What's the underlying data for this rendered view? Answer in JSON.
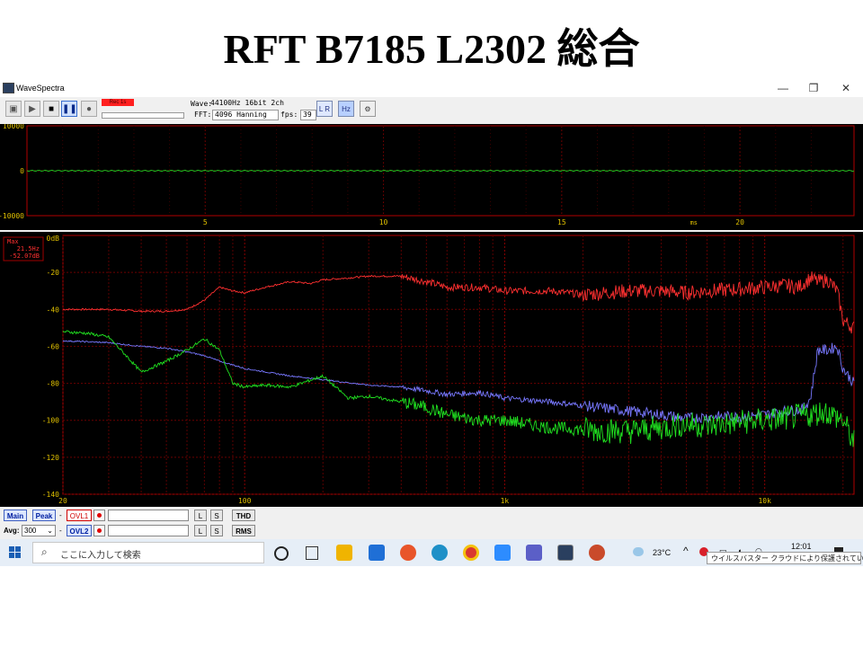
{
  "slide": {
    "title": "RFT B7185 L2302 総合"
  },
  "window": {
    "title": "WaveSpectra",
    "controls": {
      "minimize": "—",
      "restore": "❐",
      "close": "✕"
    }
  },
  "toolbar": {
    "rec_status": "Rec 1s",
    "wave_label": "Wave:",
    "wave_value": "44100Hz 16bit 2ch",
    "fft_label": "FFT:",
    "fft_value": "4096 Hanning",
    "fps_label": "fps:",
    "fps_value": "39",
    "lr_label": "L R",
    "hz_label": "Hz",
    "settings_label": "⚙"
  },
  "wave_plot": {
    "y_ticks": [
      "10000",
      "0",
      "-10000"
    ],
    "x_ticks": [
      {
        "value": 5,
        "label": "5"
      },
      {
        "value": 10,
        "label": "10"
      },
      {
        "value": 15,
        "label": "15"
      },
      {
        "value": 20,
        "label": "20"
      }
    ],
    "x_unit": "ms"
  },
  "chart_data": {
    "type": "line",
    "xscale": "log",
    "xlim": [
      20,
      22050
    ],
    "ylim": [
      -140,
      0
    ],
    "ylabel": "0dB",
    "x_tick_labels": [
      {
        "value": 20,
        "label": "20"
      },
      {
        "value": 100,
        "label": "100"
      },
      {
        "value": 1000,
        "label": "1k"
      },
      {
        "value": 10000,
        "label": "10k"
      }
    ],
    "y_ticks": [
      -20,
      -40,
      -60,
      -80,
      -100,
      -120,
      -140
    ],
    "y_tick_labels": [
      "-20",
      "-40",
      "-60",
      "-80",
      "-100",
      "-120",
      "-140"
    ],
    "max_readout": {
      "label": "Max",
      "freq": "21.5Hz",
      "level": "-52.07dB"
    },
    "series": [
      {
        "color": "#ff3030",
        "x": [
          20,
          30,
          40,
          50,
          60,
          70,
          80,
          90,
          100,
          120,
          150,
          180,
          200,
          250,
          300,
          400,
          500,
          600,
          800,
          1000,
          1500,
          2000,
          3000,
          4000,
          5000,
          6000,
          8000,
          10000,
          12000,
          13500,
          15000,
          16000,
          17500,
          19000,
          20000,
          22000
        ],
        "y": [
          -40,
          -40,
          -41,
          -41,
          -40,
          -35,
          -28,
          -30,
          -31,
          -28,
          -25,
          -26,
          -24,
          -23,
          -22,
          -22,
          -25,
          -28,
          -28,
          -30,
          -30,
          -32,
          -30,
          -30,
          -31,
          -30,
          -29,
          -28,
          -27,
          -28,
          -23,
          -25,
          -24,
          -30,
          -46,
          -50
        ]
      },
      {
        "color": "#7878ff",
        "x": [
          20,
          30,
          40,
          50,
          60,
          70,
          80,
          90,
          100,
          150,
          200,
          300,
          400,
          500,
          600,
          800,
          1000,
          1500,
          2000,
          3000,
          4000,
          5000,
          6000,
          8000,
          10000,
          12000,
          14000,
          15000,
          16000,
          17500,
          19000,
          20000,
          22000
        ],
        "y": [
          -57,
          -58,
          -60,
          -61,
          -63,
          -65,
          -68,
          -70,
          -72,
          -76,
          -78,
          -81,
          -82,
          -84,
          -86,
          -85,
          -88,
          -90,
          -92,
          -95,
          -97,
          -99,
          -98,
          -98,
          -97,
          -95,
          -94,
          -88,
          -62,
          -62,
          -60,
          -72,
          -80
        ]
      },
      {
        "color": "#20e020",
        "x": [
          20,
          25,
          30,
          35,
          40,
          50,
          60,
          70,
          80,
          90,
          100,
          120,
          150,
          200,
          250,
          300,
          400,
          500,
          600,
          800,
          1000,
          1500,
          2000,
          3000,
          4000,
          5000,
          6000,
          8000,
          10000,
          12000,
          15000,
          17000,
          20000,
          22000
        ],
        "y": [
          -52,
          -53,
          -55,
          -65,
          -74,
          -68,
          -62,
          -56,
          -62,
          -80,
          -82,
          -81,
          -82,
          -76,
          -88,
          -87,
          -90,
          -93,
          -97,
          -100,
          -100,
          -104,
          -105,
          -106,
          -104,
          -102,
          -103,
          -101,
          -100,
          -99,
          -97,
          -95,
          -100,
          -112
        ]
      }
    ]
  },
  "bottom": {
    "row1": {
      "main": "Main",
      "peak": "Peak",
      "dash": "-",
      "ovl": "OVL1",
      "l": "L",
      "s": "S",
      "extra": "THD"
    },
    "row2": {
      "avg_label": "Avg:",
      "avg_value": "300",
      "dash": "-",
      "ovl": "OVL2",
      "l": "L",
      "s": "S",
      "extra": "RMS"
    }
  },
  "taskbar": {
    "search_placeholder": "ここに入力して検索",
    "weather": "23°C",
    "clock": "12:01",
    "tooltip": "ウイルスバスター クラウドにより保護されています"
  }
}
